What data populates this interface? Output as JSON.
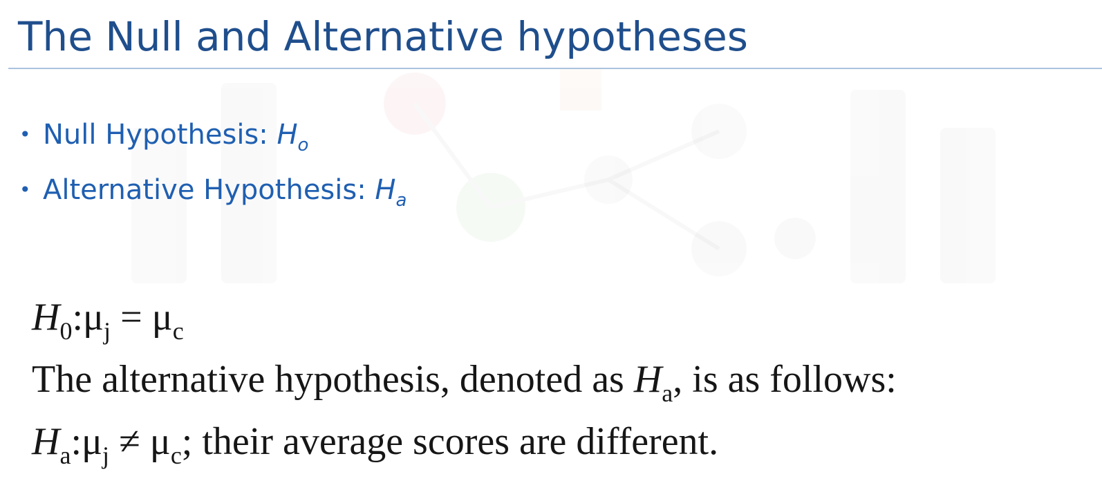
{
  "slide": {
    "title": "The Null and Alternative hypotheses",
    "bullets": [
      {
        "label": "Null Hypothesis: ",
        "symbol": "H",
        "subscript": "o"
      },
      {
        "label": "Alternative Hypothesis: ",
        "symbol": "H",
        "subscript": "a"
      }
    ],
    "equations": {
      "null": {
        "symbol": "H",
        "symbol_sub": "0",
        "sep": ":",
        "mu": "μ",
        "sub_j": "j",
        "operator": " = ",
        "sub_c": "c"
      },
      "description": {
        "text_before": "The alternative hypothesis, denoted as ",
        "symbol": "H",
        "symbol_sub": "a",
        "text_after": ", is as follows:"
      },
      "alternative": {
        "symbol": "H",
        "symbol_sub": "a",
        "sep": ":",
        "mu": "μ",
        "sub_j": "j",
        "operator": " ≠ ",
        "sub_c": "c",
        "tail": "; their average scores are different."
      }
    }
  },
  "colors": {
    "title": "#1f4e8c",
    "bullet_text": "#1f5fb1",
    "body_text": "#161616",
    "rule": "#aac2df"
  }
}
